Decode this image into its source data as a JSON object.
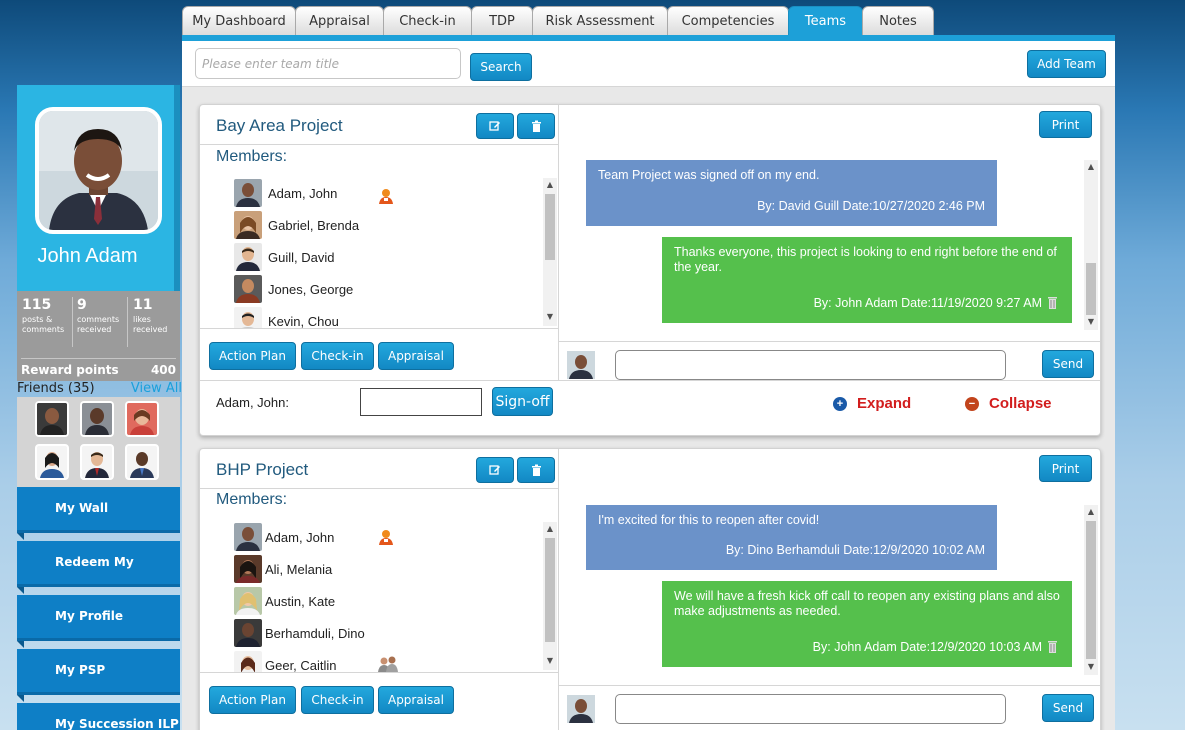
{
  "tabs": [
    "My Dashboard",
    "Appraisal",
    "Check-in",
    "TDP",
    "Risk Assessment",
    "Competencies",
    "Teams",
    "Notes"
  ],
  "active_tab": "Teams",
  "search": {
    "placeholder": "Please enter team title",
    "button": "Search"
  },
  "add_team_button": "Add Team",
  "profile": {
    "name": "John Adam",
    "stats": [
      {
        "value": "115",
        "label": "posts & comments"
      },
      {
        "value": "9",
        "label": "comments received"
      },
      {
        "value": "11",
        "label": "likes received"
      }
    ],
    "reward_label": "Reward points",
    "reward_value": "400"
  },
  "friends": {
    "title": "Friends (35)",
    "view_all": "View All"
  },
  "nav": [
    "My Wall",
    "Redeem My Points",
    "My Profile",
    "My PSP",
    "My Succession ILP"
  ],
  "teams": [
    {
      "title": "Bay Area Project",
      "members_label": "Members:",
      "members": [
        "Adam, John",
        "Gabriel, Brenda",
        "Guill, David",
        "Jones, George",
        "Kevin, Chou"
      ],
      "buttons": [
        "Action Plan",
        "Check-in",
        "Appraisal"
      ],
      "print": "Print",
      "messages": [
        {
          "text": "Team Project was signed off on my end.",
          "by": "By: David Guill Date:10/27/2020 2:46 PM",
          "color": "blue"
        },
        {
          "text": "Thanks everyone, this project is looking to end right before the end of the year.",
          "by": "By: John Adam Date:11/19/2020 9:27 AM",
          "color": "green"
        }
      ],
      "send": "Send",
      "signoff_label": "Adam, John:",
      "signoff_button": "Sign-off",
      "expand": "Expand",
      "collapse": "Collapse"
    },
    {
      "title": "BHP Project",
      "members_label": "Members:",
      "members": [
        "Adam, John",
        "Ali, Melania",
        "Austin, Kate",
        "Berhamduli, Dino",
        "Geer, Caitlin"
      ],
      "buttons": [
        "Action Plan",
        "Check-in",
        "Appraisal"
      ],
      "print": "Print",
      "messages": [
        {
          "text": "I'm excited for this to reopen after covid!",
          "by": "By: Dino Berhamduli Date:12/9/2020 10:02 AM",
          "color": "blue"
        },
        {
          "text": "We will have a fresh kick off call to reopen any existing plans and also make adjustments as needed.",
          "by": "By: John Adam Date:12/9/2020 10:03 AM",
          "color": "green"
        }
      ],
      "send": "Send"
    }
  ],
  "colors": {
    "accent": "#1da0d8",
    "blue_msg": "#6b92c9",
    "green_msg": "#55c04c",
    "nav": "#0e7fc6",
    "danger": "#d21d1d"
  },
  "icons": [
    "edit-icon",
    "trash-icon",
    "person-badge-icon",
    "plus-circle-icon",
    "minus-circle-icon"
  ]
}
